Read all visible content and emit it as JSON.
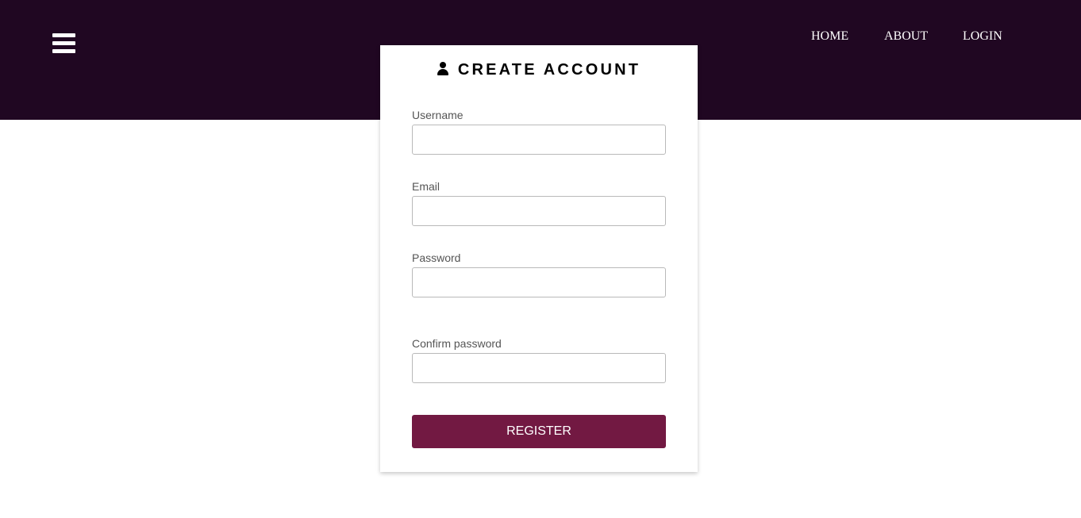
{
  "nav": {
    "menu_icon": "hamburger-menu-icon",
    "links": [
      "HOME",
      "ABOUT",
      "LOGIN"
    ]
  },
  "form": {
    "title": "CREATE ACCOUNT",
    "title_icon": "user-icon",
    "fields": [
      {
        "label": "Username",
        "value": "",
        "placeholder": ""
      },
      {
        "label": "Email",
        "value": "",
        "placeholder": ""
      },
      {
        "label": "Password",
        "value": "",
        "placeholder": ""
      },
      {
        "label": "Confirm password",
        "value": "",
        "placeholder": ""
      }
    ],
    "submit_label": "REGISTER"
  },
  "colors": {
    "header_bg": "#200722",
    "button_bg": "#721942",
    "page_bg": "#ffffff"
  }
}
